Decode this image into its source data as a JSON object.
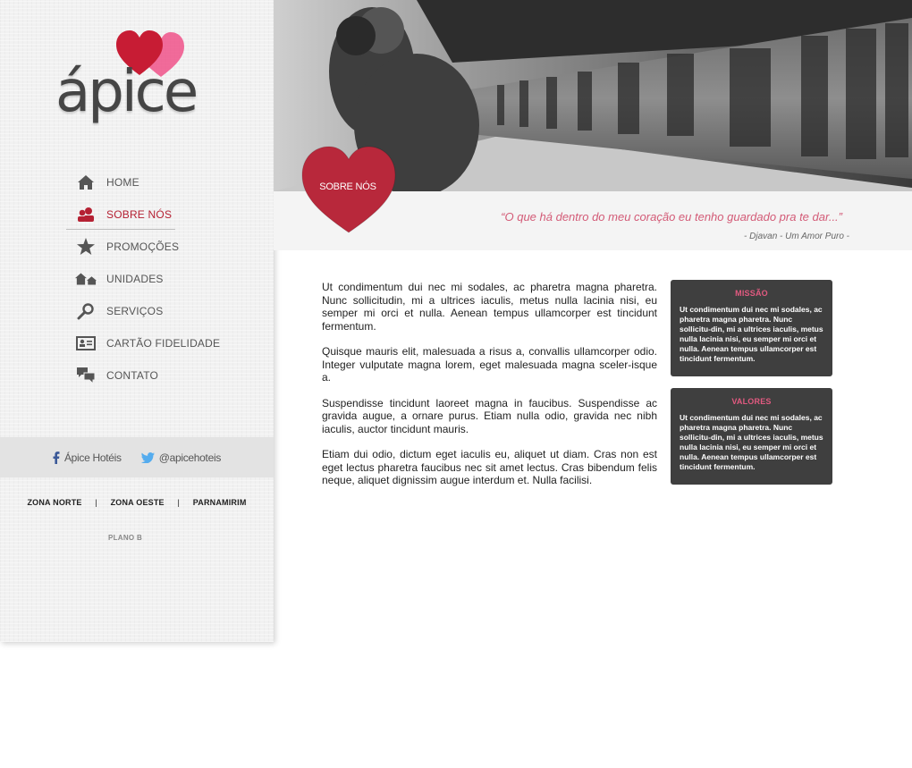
{
  "brand": {
    "logo_text": "ápice"
  },
  "nav": {
    "items": [
      {
        "label": "HOME",
        "icon": "home-icon"
      },
      {
        "label": "SOBRE NÓS",
        "icon": "users-icon",
        "active": true
      },
      {
        "label": "PROMOÇÕES",
        "icon": "star-icon"
      },
      {
        "label": "UNIDADES",
        "icon": "buildings-icon"
      },
      {
        "label": "SERVIÇOS",
        "icon": "search-icon"
      },
      {
        "label": "CARTÃO FIDELIDADE",
        "icon": "id-card-icon"
      },
      {
        "label": "CONTATO",
        "icon": "chat-icon"
      }
    ]
  },
  "social": {
    "facebook": "Ápice Hotéis",
    "twitter": "@apicehoteis"
  },
  "zones": {
    "items": [
      "ZONA NORTE",
      "ZONA OESTE",
      "PARNAMIRIM"
    ],
    "separator": "|",
    "extra": "PLANO B"
  },
  "banner": {
    "section_label": "SOBRE NÓS",
    "quote": "“O que há dentro do meu coração eu tenho guardado pra te dar...”",
    "quote_author": "- Djavan - Um Amor Puro -"
  },
  "content": {
    "paragraphs": [
      "Ut condimentum dui nec mi sodales, ac pharetra magna pharetra. Nunc sollicitudin, mi a ultrices iaculis, metus nulla lacinia nisi, eu semper mi orci et nulla. Aenean tempus ullamcorper est tincidunt fermentum.",
      "Quisque mauris elit, malesuada a risus a, convallis ullamcorper odio. Integer vulputate magna lorem, eget malesuada magna sceler-isque a.",
      "Suspendisse tincidunt laoreet magna in faucibus. Suspendisse ac gravida augue, a ornare purus. Etiam nulla odio, gravida nec nibh iaculis, auctor tincidunt mauris.",
      "Etiam dui odio, dictum eget iaculis eu, aliquet ut diam. Cras non est eget lectus pharetra faucibus nec sit amet lectus. Cras bibendum felis neque, aliquet dignissim augue interdum et. Nulla facilisi."
    ]
  },
  "boxes": [
    {
      "title": "MISSÃO",
      "text": "Ut condimentum dui nec mi sodales, ac pharetra magna pharetra. Nunc sollicitu-din, mi a ultrices iaculis, metus nulla lacinia nisi, eu semper mi orci et nulla. Aenean tempus ullamcorper est tincidunt fermentum."
    },
    {
      "title": "VALORES",
      "text": "Ut condimentum dui nec mi sodales, ac pharetra magna pharetra. Nunc sollicitu-din, mi a ultrices iaculis, metus nulla lacinia nisi, eu semper mi orci et nulla. Aenean tempus ullamcorper est tincidunt fermentum."
    }
  ],
  "colors": {
    "accent": "#b52133",
    "quote": "#d35b77",
    "box_bg": "#3f3f3f",
    "box_title": "#e25a80"
  }
}
